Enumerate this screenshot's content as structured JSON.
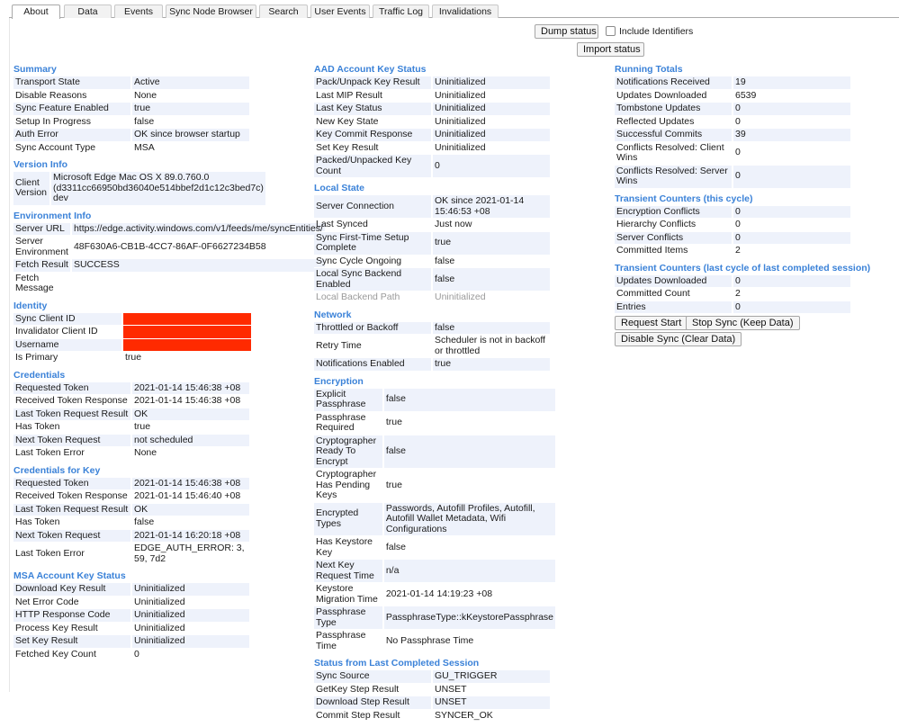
{
  "tabs": [
    {
      "label": "About",
      "active": true
    },
    {
      "label": "Data"
    },
    {
      "label": "Events"
    },
    {
      "label": "Sync Node Browser"
    },
    {
      "label": "Search"
    },
    {
      "label": "User Events"
    },
    {
      "label": "Traffic Log"
    },
    {
      "label": "Invalidations"
    }
  ],
  "toolbar": {
    "dump_status": "Dump status",
    "include_identifiers": "Include Identifiers",
    "include_identifiers_checked": false,
    "import_status": "Import status"
  },
  "colors": {
    "section_title": "#3b82d8",
    "row_stripe": "#eef2fb",
    "redaction": "#ff2a00"
  },
  "left": {
    "summary": {
      "title": "Summary",
      "rows": [
        [
          "Transport State",
          "Active"
        ],
        [
          "Disable Reasons",
          "None"
        ],
        [
          "Sync Feature Enabled",
          "true"
        ],
        [
          "Setup In Progress",
          "false"
        ],
        [
          "Auth Error",
          "OK since browser startup"
        ],
        [
          "Sync Account Type",
          "MSA"
        ]
      ]
    },
    "version": {
      "title": "Version Info",
      "rows": [
        [
          "Client Version",
          "Microsoft Edge Mac OS X 89.0.760.0 (d3311cc66950bd36040e514bbef2d1c12c3bed7c) dev"
        ]
      ]
    },
    "environment": {
      "title": "Environment Info",
      "rows": [
        [
          "Server URL",
          "https://edge.activity.windows.com/v1/feeds/me/syncEntities/"
        ],
        [
          "Server Environment",
          "48F630A6-CB1B-4CC7-86AF-0F6627234B58"
        ],
        [
          "Fetch Result",
          "SUCCESS"
        ],
        [
          "Fetch Message",
          ""
        ]
      ]
    },
    "identity": {
      "title": "Identity",
      "rows": [
        [
          "Sync Client ID",
          ""
        ],
        [
          "Invalidator Client ID",
          ""
        ],
        [
          "Username",
          ""
        ],
        [
          "Is Primary",
          "true"
        ]
      ]
    },
    "credentials": {
      "title": "Credentials",
      "rows": [
        [
          "Requested Token",
          "2021-01-14 15:46:38 +08"
        ],
        [
          "Received Token Response",
          "2021-01-14 15:46:38 +08"
        ],
        [
          "Last Token Request Result",
          "OK"
        ],
        [
          "Has Token",
          "true"
        ],
        [
          "Next Token Request",
          "not scheduled"
        ],
        [
          "Last Token Error",
          "None"
        ]
      ]
    },
    "credentials_key": {
      "title": "Credentials for Key",
      "rows": [
        [
          "Requested Token",
          "2021-01-14 15:46:38 +08"
        ],
        [
          "Received Token Response",
          "2021-01-14 15:46:40 +08"
        ],
        [
          "Last Token Request Result",
          "OK"
        ],
        [
          "Has Token",
          "false"
        ],
        [
          "Next Token Request",
          "2021-01-14 16:20:18 +08"
        ],
        [
          "Last Token Error",
          "EDGE_AUTH_ERROR: 3, 59, 7d2"
        ]
      ]
    },
    "msa_key": {
      "title": "MSA Account Key Status",
      "rows": [
        [
          "Download Key Result",
          "Uninitialized"
        ],
        [
          "Net Error Code",
          "Uninitialized"
        ],
        [
          "HTTP Response Code",
          "Uninitialized"
        ],
        [
          "Process Key Result",
          "Uninitialized"
        ],
        [
          "Set Key Result",
          "Uninitialized"
        ],
        [
          "Fetched Key Count",
          "0"
        ]
      ]
    }
  },
  "middle": {
    "aad_key": {
      "title": "AAD Account Key Status",
      "rows": [
        [
          "Pack/Unpack Key Result",
          "Uninitialized"
        ],
        [
          "Last MIP Result",
          "Uninitialized"
        ],
        [
          "Last Key Status",
          "Uninitialized"
        ],
        [
          "New Key State",
          "Uninitialized"
        ],
        [
          "Key Commit Response",
          "Uninitialized"
        ],
        [
          "Set Key Result",
          "Uninitialized"
        ],
        [
          "Packed/Unpacked Key Count",
          "0"
        ]
      ]
    },
    "local_state": {
      "title": "Local State",
      "rows": [
        [
          "Server Connection",
          "OK since 2021-01-14 15:46:53 +08"
        ],
        [
          "Last Synced",
          "Just now"
        ],
        [
          "Sync First-Time Setup Complete",
          "true"
        ],
        [
          "Sync Cycle Ongoing",
          "false"
        ],
        [
          "Local Sync Backend Enabled",
          "false"
        ],
        [
          "Local Backend Path",
          "Uninitialized"
        ]
      ]
    },
    "network": {
      "title": "Network",
      "rows": [
        [
          "Throttled or Backoff",
          "false"
        ],
        [
          "Retry Time",
          "Scheduler is not in backoff or throttled"
        ],
        [
          "Notifications Enabled",
          "true"
        ]
      ]
    },
    "encryption": {
      "title": "Encryption",
      "rows": [
        [
          "Explicit Passphrase",
          "false"
        ],
        [
          "Passphrase Required",
          "true"
        ],
        [
          "Cryptographer Ready To Encrypt",
          "false"
        ],
        [
          "Cryptographer Has Pending Keys",
          "true"
        ],
        [
          "Encrypted Types",
          "Passwords, Autofill Profiles, Autofill, Autofill Wallet Metadata, Wifi Configurations"
        ],
        [
          "Has Keystore Key",
          "false"
        ],
        [
          "Next Key Request Time",
          "n/a"
        ],
        [
          "Keystore Migration Time",
          "2021-01-14 14:19:23 +08"
        ],
        [
          "Passphrase Type",
          "PassphraseType::kKeystorePassphrase"
        ],
        [
          "Passphrase Time",
          "No Passphrase Time"
        ]
      ]
    },
    "last_session": {
      "title": "Status from Last Completed Session",
      "rows": [
        [
          "Sync Source",
          "GU_TRIGGER"
        ],
        [
          "GetKey Step Result",
          "UNSET"
        ],
        [
          "Download Step Result",
          "UNSET"
        ],
        [
          "Commit Step Result",
          "SYNCER_OK"
        ]
      ]
    }
  },
  "right": {
    "running_totals": {
      "title": "Running Totals",
      "rows": [
        [
          "Notifications Received",
          "19"
        ],
        [
          "Updates Downloaded",
          "6539"
        ],
        [
          "Tombstone Updates",
          "0"
        ],
        [
          "Reflected Updates",
          "0"
        ],
        [
          "Successful Commits",
          "39"
        ],
        [
          "Conflicts Resolved: Client Wins",
          "0"
        ],
        [
          "Conflicts Resolved: Server Wins",
          "0"
        ]
      ]
    },
    "transient_cycle": {
      "title": "Transient Counters (this cycle)",
      "rows": [
        [
          "Encryption Conflicts",
          "0"
        ],
        [
          "Hierarchy Conflicts",
          "0"
        ],
        [
          "Server Conflicts",
          "0"
        ],
        [
          "Committed Items",
          "2"
        ]
      ]
    },
    "transient_last": {
      "title": "Transient Counters (last cycle of last completed session)",
      "rows": [
        [
          "Updates Downloaded",
          "0"
        ],
        [
          "Committed Count",
          "2"
        ],
        [
          "Entries",
          "0"
        ]
      ]
    },
    "buttons": {
      "request_start": "Request Start",
      "stop_sync": "Stop Sync (Keep Data)",
      "disable_sync": "Disable Sync (Clear Data)"
    }
  }
}
